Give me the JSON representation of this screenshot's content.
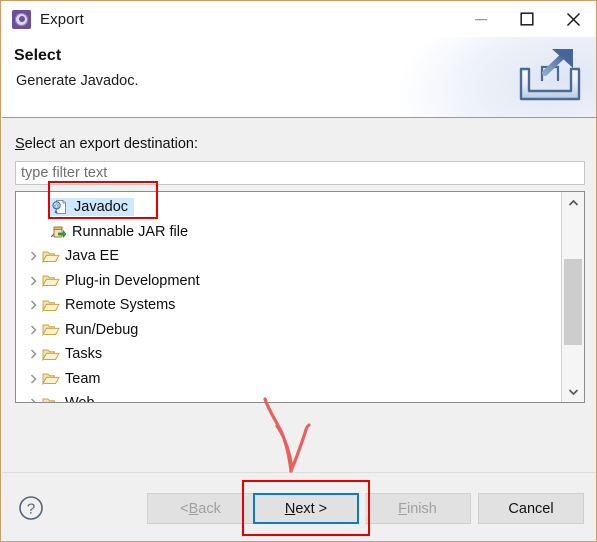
{
  "window": {
    "title": "Export",
    "icon": "eclipse-app-icon",
    "border_color": "#d49a62",
    "controls": [
      {
        "name": "minimize",
        "glyph": "minimize-icon"
      },
      {
        "name": "maximize",
        "glyph": "maximize-icon"
      },
      {
        "name": "close",
        "glyph": "close-icon"
      }
    ]
  },
  "header": {
    "title": "Select",
    "subtitle": "Generate Javadoc.",
    "banner_icon": "export-wizard-icon"
  },
  "body": {
    "field_label": "Select an export destination:",
    "field_label_mnemonic": "S",
    "filter": {
      "value": "",
      "placeholder": "type filter text"
    },
    "tree": [
      {
        "label": "Javadoc",
        "icon": "javadoc-icon",
        "type": "leaf",
        "selected": true,
        "expandable": false
      },
      {
        "label": "Runnable JAR file",
        "icon": "runnable-jar-icon",
        "type": "leaf",
        "selected": false,
        "expandable": false
      },
      {
        "label": "Java EE",
        "icon": "folder-icon",
        "type": "node",
        "selected": false,
        "expandable": true
      },
      {
        "label": "Plug-in Development",
        "icon": "folder-icon",
        "type": "node",
        "selected": false,
        "expandable": true
      },
      {
        "label": "Remote Systems",
        "icon": "folder-icon",
        "type": "node",
        "selected": false,
        "expandable": true
      },
      {
        "label": "Run/Debug",
        "icon": "folder-icon",
        "type": "node",
        "selected": false,
        "expandable": true
      },
      {
        "label": "Tasks",
        "icon": "folder-icon",
        "type": "node",
        "selected": false,
        "expandable": true
      },
      {
        "label": "Team",
        "icon": "folder-icon",
        "type": "node",
        "selected": false,
        "expandable": true
      },
      {
        "label": "Web",
        "icon": "folder-icon",
        "type": "node",
        "selected": false,
        "expandable": true
      }
    ],
    "scrollbar": {
      "up_glyph": "chevron-up-icon",
      "down_glyph": "chevron-down-icon"
    },
    "selection_color": "#cde8ff"
  },
  "footer": {
    "help_label": "?",
    "buttons": [
      {
        "name": "back",
        "label": "< Back",
        "mnemonic": "B",
        "enabled": false,
        "focused": false
      },
      {
        "name": "next",
        "label": "Next >",
        "mnemonic": "N",
        "enabled": true,
        "focused": true
      },
      {
        "name": "finish",
        "label": "Finish",
        "mnemonic": "F",
        "enabled": false,
        "focused": false
      },
      {
        "name": "cancel",
        "label": "Cancel",
        "mnemonic": "",
        "enabled": true,
        "focused": false
      }
    ],
    "focus_color": "#0a7ad1"
  },
  "annotations": {
    "color": "#e60000",
    "shapes": [
      {
        "name": "javadoc-highlight-rect",
        "kind": "rectangle"
      },
      {
        "name": "next-button-highlight-rect",
        "kind": "rectangle"
      },
      {
        "name": "pointer-arrow-scribble",
        "kind": "freehand-arrow"
      }
    ]
  }
}
